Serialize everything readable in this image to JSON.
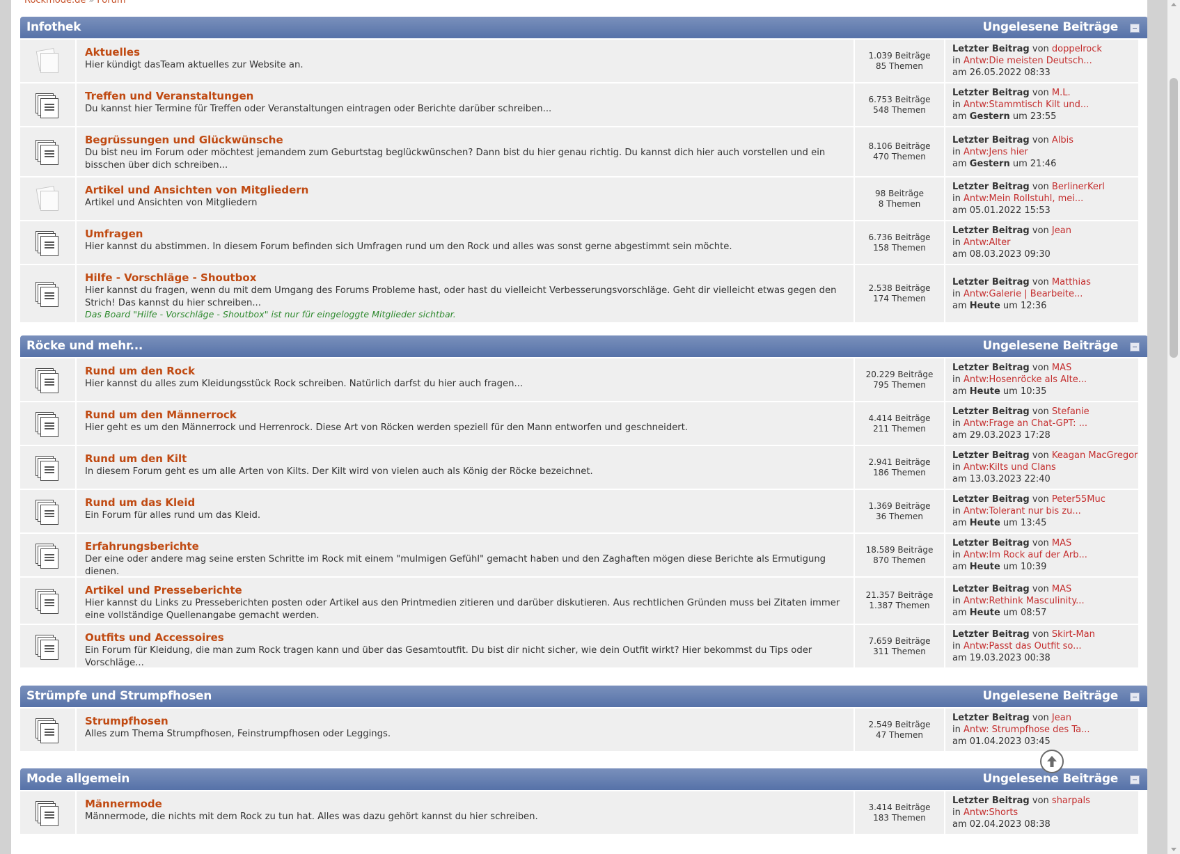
{
  "breadcrumb": {
    "home": "Rockmode.de",
    "separator": "»",
    "current": "Forum"
  },
  "labels": {
    "last_post": "Letzter Beitrag",
    "by": "von",
    "in": "in",
    "on": "am"
  },
  "categories": [
    {
      "title": "Infothek",
      "unread": "Ungelesene Beiträge",
      "boards": [
        {
          "name": "Aktuelles",
          "desc": "Hier kündigt dasTeam aktuelles zur Website an.",
          "note": "",
          "icon": "old",
          "posts": "1.039 Beiträge",
          "topics": "85 Themen",
          "last_user": "doppelrock",
          "last_topic": "Antw:Die meisten Deutsch...",
          "last_date_pre": "26.05.2022 08:33",
          "last_date_bold": "",
          "last_time": ""
        },
        {
          "name": "Treffen und Veranstaltungen",
          "desc": "Du kannst hier Termine für Treffen oder Veranstaltungen eintragen oder Berichte darüber schreiben...",
          "note": "",
          "icon": "new",
          "posts": "6.753 Beiträge",
          "topics": "548 Themen",
          "last_user": "M.L.",
          "last_topic": "Antw:Stammtisch Kilt und...",
          "last_date_pre": "",
          "last_date_bold": "Gestern",
          "last_time": "um 23:55"
        },
        {
          "name": "Begrüssungen und Glückwünsche",
          "desc": "Du bist neu im Forum oder möchtest jemandem zum Geburtstag beglückwünschen? Dann bist du hier genau richtig. Du kannst dich hier auch vorstellen und ein bisschen über dich schreiben...",
          "note": "",
          "icon": "new",
          "posts": "8.106 Beiträge",
          "topics": "470 Themen",
          "last_user": "Albis",
          "last_topic": "Antw:Jens hier",
          "last_date_pre": "",
          "last_date_bold": "Gestern",
          "last_time": "um 21:46"
        },
        {
          "name": "Artikel und Ansichten von Mitgliedern",
          "desc": "Artikel und Ansichten von Mitgliedern",
          "note": "",
          "icon": "old",
          "posts": "98 Beiträge",
          "topics": "8 Themen",
          "last_user": "BerlinerKerl",
          "last_topic": "Antw:Mein Rollstuhl, mei...",
          "last_date_pre": "05.01.2022 15:53",
          "last_date_bold": "",
          "last_time": ""
        },
        {
          "name": "Umfragen",
          "desc": "Hier kannst du abstimmen. In diesem Forum befinden sich Umfragen rund um den Rock und alles was sonst gerne abgestimmt sein möchte.",
          "note": "",
          "icon": "new",
          "posts": "6.736 Beiträge",
          "topics": "158 Themen",
          "last_user": "Jean",
          "last_topic": "Antw:Alter",
          "last_date_pre": "08.03.2023 09:30",
          "last_date_bold": "",
          "last_time": ""
        },
        {
          "name": "Hilfe - Vorschläge - Shoutbox",
          "desc": "Hier kannst du fragen, wenn du mit dem Umgang des Forums Probleme hast, oder hast du vielleicht Verbesserungsvorschläge. Geht dir vielleicht etwas gegen den Strich! Das kannst du hier schreiben...",
          "note": "Das Board \"Hilfe - Vorschläge - Shoutbox\" ist nur für eingeloggte Mitglieder sichtbar.",
          "icon": "new",
          "posts": "2.538 Beiträge",
          "topics": "174 Themen",
          "last_user": "Matthias",
          "last_topic": "Antw:Galerie | Bearbeite...",
          "last_date_pre": "",
          "last_date_bold": "Heute",
          "last_time": "um 12:36"
        }
      ]
    },
    {
      "title": "Röcke und mehr...",
      "unread": "Ungelesene Beiträge",
      "boards": [
        {
          "name": "Rund um den Rock",
          "desc": "Hier kannst du alles zum Kleidungsstück Rock schreiben. Natürlich darfst du hier auch fragen...",
          "note": "",
          "icon": "new",
          "posts": "20.229 Beiträge",
          "topics": "795 Themen",
          "last_user": "MAS",
          "last_topic": "Antw:Hosenröcke als Alte...",
          "last_date_pre": "",
          "last_date_bold": "Heute",
          "last_time": "um 10:35"
        },
        {
          "name": "Rund um den Männerrock",
          "desc": "Hier geht es um den Männerrock und Herrenrock. Diese Art von Röcken werden speziell für den Mann entworfen und geschneidert.",
          "note": "",
          "icon": "new",
          "posts": "4.414 Beiträge",
          "topics": "211 Themen",
          "last_user": "Stefanie",
          "last_topic": "Antw:Frage an Chat-GPT: ...",
          "last_date_pre": "29.03.2023 17:28",
          "last_date_bold": "",
          "last_time": ""
        },
        {
          "name": "Rund um den Kilt",
          "desc": "In diesem Forum geht es um alle Arten von Kilts. Der Kilt wird von vielen auch als König der Röcke bezeichnet.",
          "note": "",
          "icon": "new",
          "posts": "2.941 Beiträge",
          "topics": "186 Themen",
          "last_user": "Keagan MacGregor",
          "last_topic": "Antw:Kilts und Clans",
          "last_date_pre": "13.03.2023 22:40",
          "last_date_bold": "",
          "last_time": ""
        },
        {
          "name": "Rund um das Kleid",
          "desc": "Ein Forum für alles rund um das Kleid.",
          "note": "",
          "icon": "new",
          "posts": "1.369 Beiträge",
          "topics": "36 Themen",
          "last_user": "Peter55Muc",
          "last_topic": "Antw:Tolerant nur bis zu...",
          "last_date_pre": "",
          "last_date_bold": "Heute",
          "last_time": "um 13:45"
        },
        {
          "name": "Erfahrungsberichte",
          "desc": "Der eine oder andere mag seine ersten Schritte im Rock mit einem \"mulmigen Gefühl\" gemacht haben und den Zaghaften mögen diese Berichte als Ermutigung dienen.",
          "note": "",
          "icon": "new",
          "posts": "18.589 Beiträge",
          "topics": "870 Themen",
          "last_user": "MAS",
          "last_topic": "Antw:Im Rock auf der Arb...",
          "last_date_pre": "",
          "last_date_bold": "Heute",
          "last_time": "um 10:39"
        },
        {
          "name": "Artikel und Presseberichte",
          "desc": "Hier kannst du Links zu Presseberichten posten oder Artikel aus den Printmedien zitieren und darüber diskutieren. Aus rechtlichen Gründen muss bei Zitaten immer eine vollständige Quellenangabe gemacht werden.",
          "note": "",
          "icon": "new",
          "posts": "21.357 Beiträge",
          "topics": "1.387 Themen",
          "last_user": "MAS",
          "last_topic": "Antw:Rethink Masculinity...",
          "last_date_pre": "",
          "last_date_bold": "Heute",
          "last_time": "um 08:57"
        },
        {
          "name": "Outfits und Accessoires",
          "desc": "Ein Forum für Kleidung, die man zum Rock tragen kann und über das Gesamtoutfit. Du bist dir nicht sicher, wie dein Outfit wirkt? Hier bekommst du Tips oder Vorschläge...",
          "note": "",
          "icon": "new",
          "posts": "7.659 Beiträge",
          "topics": "311 Themen",
          "last_user": "Skirt-Man",
          "last_topic": "Antw:Passt das Outfit so...",
          "last_date_pre": "19.03.2023 00:38",
          "last_date_bold": "",
          "last_time": ""
        }
      ]
    },
    {
      "title": "Strümpfe und Strumpfhosen",
      "unread": "Ungelesene Beiträge",
      "boards": [
        {
          "name": "Strumpfhosen",
          "desc": "Alles zum Thema Strumpfhosen, Feinstrumpfhosen oder Leggings.",
          "note": "",
          "icon": "new",
          "posts": "2.549 Beiträge",
          "topics": "47 Themen",
          "last_user": "Jean",
          "last_topic": "Antw: Strumpfhose des Ta...",
          "last_date_pre": "01.04.2023 03:45",
          "last_date_bold": "",
          "last_time": ""
        }
      ]
    },
    {
      "title": "Mode allgemein",
      "unread": "Ungelesene Beiträge",
      "boards": [
        {
          "name": "Männermode",
          "desc": "Männermode, die nichts mit dem Rock zu tun hat. Alles was dazu gehört kannst du hier schreiben.",
          "note": "",
          "icon": "new",
          "posts": "3.414 Beiträge",
          "topics": "183 Themen",
          "last_user": "sharpals",
          "last_topic": "Antw:Shorts",
          "last_date_pre": "02.04.2023 08:38",
          "last_date_bold": "",
          "last_time": ""
        }
      ]
    }
  ]
}
